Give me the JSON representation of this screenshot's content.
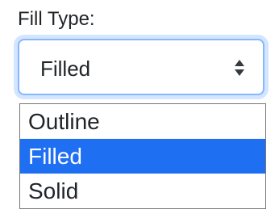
{
  "field": {
    "label": "Fill Type:",
    "selected_value": "Filled",
    "icon": "sort-up-down-icon",
    "focus_color": "#86b7fe"
  },
  "dropdown": {
    "options": [
      {
        "label": "Outline",
        "selected": false
      },
      {
        "label": "Filled",
        "selected": true
      },
      {
        "label": "Solid",
        "selected": false
      }
    ],
    "highlight_color": "#1e6ff2"
  }
}
